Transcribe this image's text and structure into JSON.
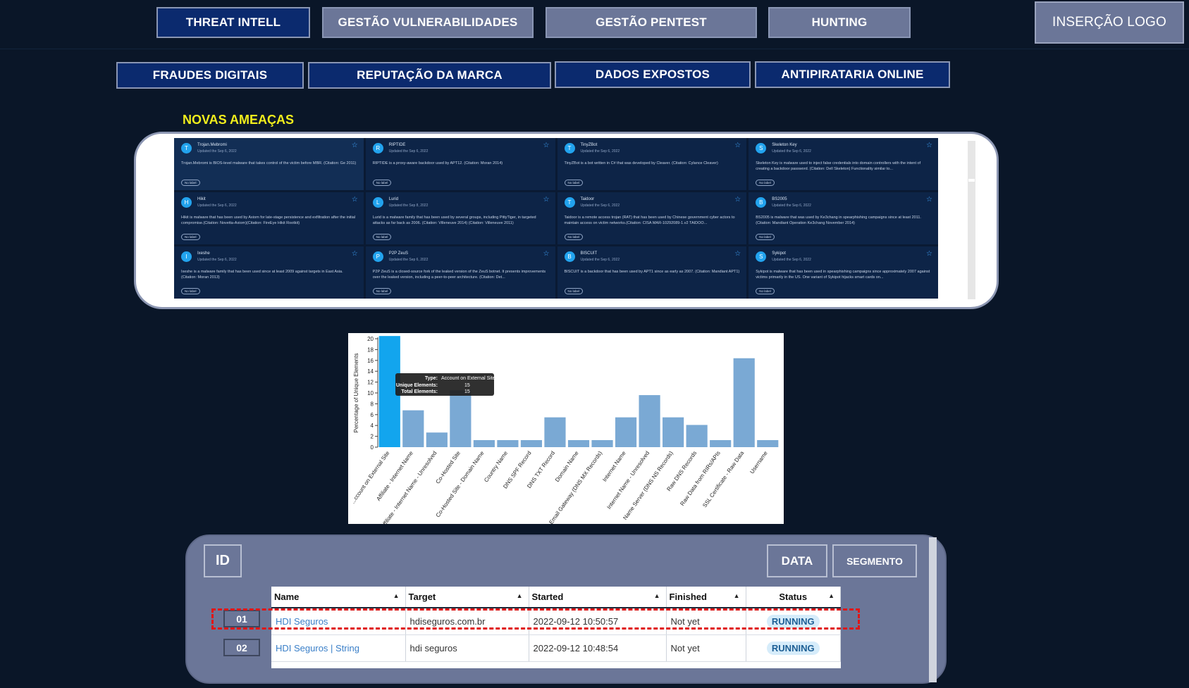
{
  "nav": {
    "row1": [
      "THREAT INTELL",
      "GESTÃO VULNERABILIDADES",
      "GESTÃO PENTEST",
      "HUNTING"
    ],
    "logo": "INSERÇÃO LOGO",
    "row2": [
      "FRAUDES DIGITAIS",
      "REPUTAÇÃO DA MARCA",
      "DADOS EXPOSTOS",
      "ANTIPIRATARIA ONLINE"
    ]
  },
  "threats": {
    "title": "NOVAS AMEAÇAS",
    "cards": [
      {
        "initial": "T",
        "name": "Trojan.Mebromi",
        "updated": "Updated the Sep 6, 2022",
        "desc": "Trojan.Mebromi is BIOS-level malware that takes control of the victim before MBR. (Citation: Ge 2011)",
        "label": "No label"
      },
      {
        "initial": "R",
        "name": "RIPTIDE",
        "updated": "Updated the Sep 6, 2022",
        "desc": "RIPTIDE is a proxy-aware backdoor used by APT12. (Citation: Moran 2014)",
        "label": "No label"
      },
      {
        "initial": "T",
        "name": "TinyZBot",
        "updated": "Updated the Sep 6, 2022",
        "desc": "TinyZBot is a bot written in C# that was developed by Cleaver. (Citation: Cylance Cleaver)",
        "label": "No label"
      },
      {
        "initial": "S",
        "name": "Skeleton Key",
        "updated": "Updated the Sep 6, 2022",
        "desc": "Skeleton Key is malware used to inject false credentials into domain controllers with the intent of creating a backdoor password. (Citation: Dell Skeleton) Functionality similar to...",
        "label": "No label"
      },
      {
        "initial": "H",
        "name": "Hikit",
        "updated": "Updated the Sep 6, 2022",
        "desc": "Hikit is malware that has been used by Axiom for late-stage persistence and exfiltration after the initial compromise.(Citation: Novetta-Axiom)(Citation: FireEye Hikit Rootkit)",
        "label": "No label"
      },
      {
        "initial": "L",
        "name": "Lurid",
        "updated": "Updated the Sep 8, 2022",
        "desc": "Lurid is a malware family that has been used by several groups, including PittyTiger, in targeted attacks as far back as 2006. (Citation: Villeneuve 2014) (Citation: Villeneuve 2011)",
        "label": "No label"
      },
      {
        "initial": "T",
        "name": "Taidoor",
        "updated": "Updated the Sep 6, 2022",
        "desc": "Taidoor is a remote access trojan (RAT) that has been used by Chinese government cyber actors to maintain access on victim networks.(Citation: CISA MAR-10292089-1.v2 TAIDOO...",
        "label": "No label"
      },
      {
        "initial": "B",
        "name": "BS2005",
        "updated": "Updated the Sep 6, 2022",
        "desc": "BS2005 is malware that was used by Ke3chang in spearphishing campaigns since at least 2011. (Citation: Mandiant Operation Ke3chang November 2014)",
        "label": "No label"
      },
      {
        "initial": "I",
        "name": "Ixeshe",
        "updated": "Updated the Sep 6, 2022",
        "desc": "Ixeshe is a malware family that has been used since at least 2009 against targets in East Asia. (Citation: Moran 2013)",
        "label": "No label"
      },
      {
        "initial": "P",
        "name": "P2P ZeuS",
        "updated": "Updated the Sep 6, 2022",
        "desc": "P2P ZeuS is a closed-source fork of the leaked version of the ZeuS botnet. It presents improvements over the leaked version, including a peer-to-peer architecture. (Citation: Det...",
        "label": "No label"
      },
      {
        "initial": "B",
        "name": "BISCUIT",
        "updated": "Updated the Sep 6, 2022",
        "desc": "BISCUIT is a backdoor that has been used by APT1 since as early as 2007. (Citation: Mandiant APT1)",
        "label": "No label"
      },
      {
        "initial": "S",
        "name": "Sykipot",
        "updated": "Updated the Sep 6, 2022",
        "desc": "Sykipot is malware that has been used in spearphishing campaigns since approximately 2007 against victims primarily in the US. One variant of Sykipot hijacks smart cards on...",
        "label": "No label"
      }
    ]
  },
  "chart_data": {
    "type": "bar",
    "ylabel": "Percentage of Unique Elements",
    "ylim": [
      0,
      20
    ],
    "yticks": [
      0,
      2,
      4,
      6,
      8,
      10,
      12,
      14,
      16,
      18,
      20
    ],
    "categories": [
      "...ccount on External Site",
      "Affiliate - Internet Name",
      "Affiliate - Internet Name - Unresolved",
      "Co-Hosted Site",
      "Co-Hosted Site - Domain Name",
      "Country Name",
      "DNS SPF Record",
      "DNS TXT Record",
      "Domain Name",
      "Email Gateway (DNS MX Records)",
      "Internet Name",
      "Internet Name - Unresolved",
      "Name Server (DNS NS Records)",
      "Raw DNS Records",
      "Raw Data from RIRs/APIs",
      "SSL Certificate - Raw Data",
      "Username"
    ],
    "values": [
      20.5,
      6.8,
      2.7,
      10.5,
      1.3,
      1.3,
      1.3,
      5.5,
      1.3,
      1.3,
      5.5,
      9.6,
      5.5,
      4.1,
      1.3,
      16.4,
      1.3
    ],
    "highlight_color": "#12a5ee",
    "bar_color": "#7aa9d4",
    "tooltip": {
      "type_label": "Type:",
      "type_value": "Account on External Site",
      "unique_label": "Unique Elements:",
      "unique_value": "15",
      "total_label": "Total Elements:",
      "total_value": "15"
    }
  },
  "results": {
    "id_label": "ID",
    "data_button": "DATA",
    "segment_button": "SEGMENTO",
    "columns": [
      "Name",
      "Target",
      "Started",
      "Finished",
      "Status"
    ],
    "rows": [
      {
        "id": "01",
        "name": "HDI Seguros",
        "target": "hdiseguros.com.br",
        "started": "2022-09-12 10:50:57",
        "finished": "Not yet",
        "status": "RUNNING"
      },
      {
        "id": "02",
        "name": "HDI Seguros | String",
        "target": "hdi seguros",
        "started": "2022-09-12 10:48:54",
        "finished": "Not yet",
        "status": "RUNNING"
      }
    ]
  }
}
